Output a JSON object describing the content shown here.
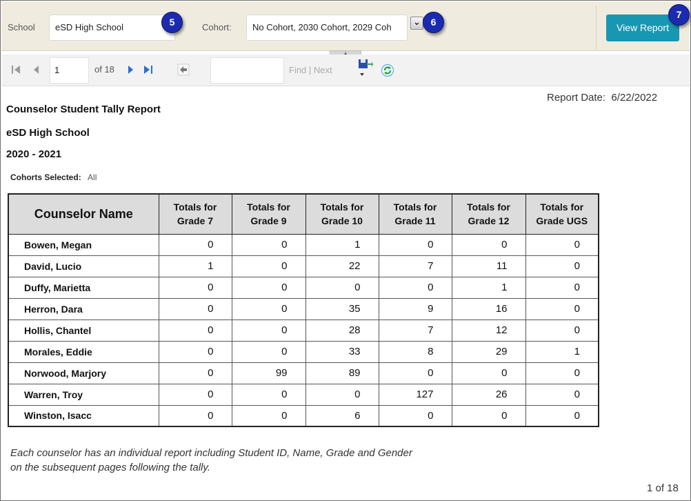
{
  "params": {
    "school_label": "School",
    "school_value": "eSD High School",
    "cohort_label": "Cohort:",
    "cohort_value": "No Cohort, 2030 Cohort, 2029 Coh",
    "view_report_label": "View Report"
  },
  "badges": [
    "5",
    "6",
    "7"
  ],
  "toolbar": {
    "page_value": "1",
    "of_label": "of 18",
    "find_label": "Find | Next"
  },
  "report": {
    "date_label": "Report Date:",
    "date_value": "6/22/2022",
    "title": "Counselor Student Tally Report",
    "school": "eSD High School",
    "year": "2020 - 2021",
    "cohorts_label": "Cohorts Selected:",
    "cohorts_value": "All",
    "columns": [
      "Counselor Name",
      "Totals for Grade 7",
      "Totals for Grade 9",
      "Totals for Grade 10",
      "Totals for Grade 11",
      "Totals for Grade 12",
      "Totals for Grade UGS"
    ],
    "rows": [
      [
        "Bowen, Megan",
        "0",
        "0",
        "1",
        "0",
        "0",
        "0"
      ],
      [
        "David, Lucio",
        "1",
        "0",
        "22",
        "7",
        "11",
        "0"
      ],
      [
        "Duffy, Marietta",
        "0",
        "0",
        "0",
        "0",
        "1",
        "0"
      ],
      [
        "Herron, Dara",
        "0",
        "0",
        "35",
        "9",
        "16",
        "0"
      ],
      [
        "Hollis, Chantel",
        "0",
        "0",
        "28",
        "7",
        "12",
        "0"
      ],
      [
        "Morales, Eddie",
        "0",
        "0",
        "33",
        "8",
        "29",
        "1"
      ],
      [
        "Norwood, Marjory",
        "0",
        "99",
        "89",
        "0",
        "0",
        "0"
      ],
      [
        "Warren, Troy",
        "0",
        "0",
        "0",
        "127",
        "26",
        "0"
      ],
      [
        "Winston, Isacc",
        "0",
        "0",
        "6",
        "0",
        "0",
        "0"
      ]
    ],
    "footnote_line1": "Each counselor has an individual report including Student ID, Name, Grade and Gender",
    "footnote_line2": "on the subsequent pages following the tally.",
    "page_count": "1 of 18"
  },
  "colors": {
    "param_bar": "#efecdf",
    "badge": "#1b2bb0",
    "view_button": "#1797b1",
    "nav_arrow": "#2a6dd0",
    "header_fill": "#dcdcdc"
  }
}
